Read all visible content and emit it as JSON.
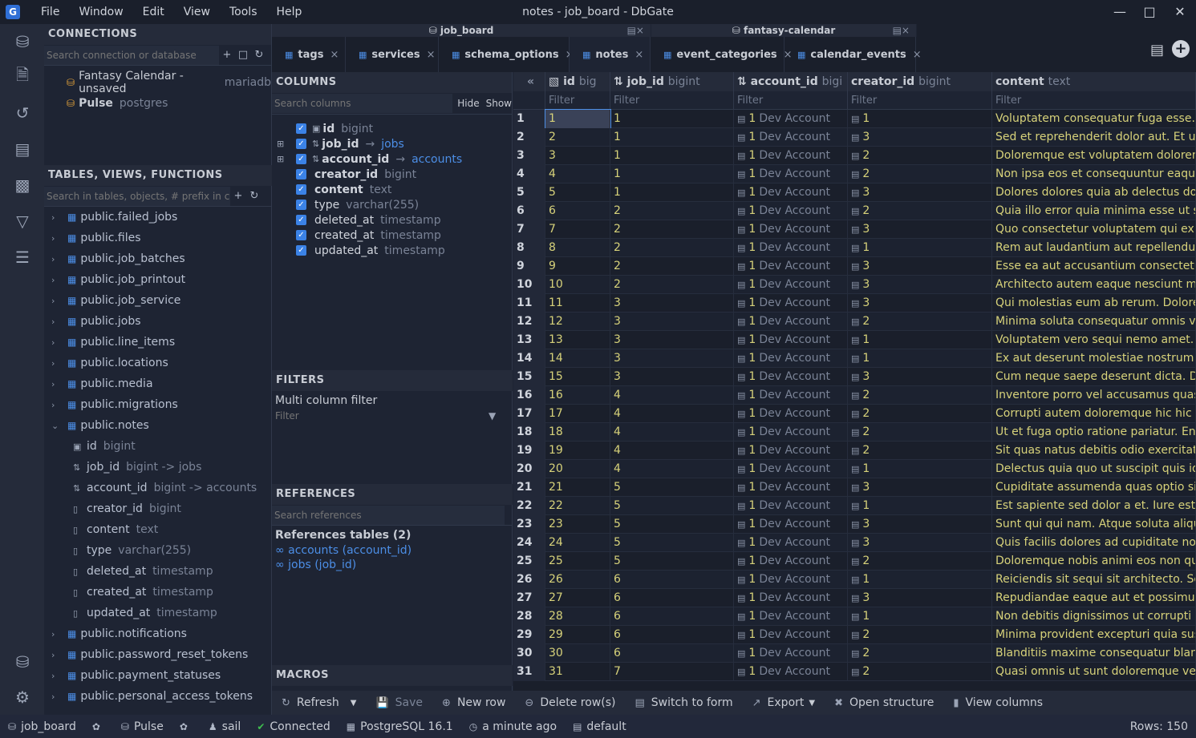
{
  "title": "notes - job_board - DbGate",
  "menu": [
    "File",
    "Window",
    "Edit",
    "View",
    "Tools",
    "Help"
  ],
  "connections": {
    "header": "CONNECTIONS",
    "search_placeholder": "Search connection or database",
    "items": [
      {
        "name": "Fantasy Calendar - unsaved",
        "driver": "mariadb"
      },
      {
        "name": "Pulse",
        "driver": "postgres"
      }
    ]
  },
  "tables": {
    "header": "TABLES, VIEWS, FUNCTIONS",
    "search_placeholder": "Search in tables, objects, # prefix in col",
    "items_before": [
      "public.failed_jobs",
      "public.files",
      "public.job_batches",
      "public.job_printout",
      "public.job_service",
      "public.jobs",
      "public.line_items",
      "public.locations",
      "public.media",
      "public.migrations",
      "public.notes"
    ],
    "notes_columns": [
      {
        "name": "id",
        "type": "bigint"
      },
      {
        "name": "job_id",
        "type": "bigint -> jobs"
      },
      {
        "name": "account_id",
        "type": "bigint -> accounts"
      },
      {
        "name": "creator_id",
        "type": "bigint"
      },
      {
        "name": "content",
        "type": "text"
      },
      {
        "name": "type",
        "type": "varchar(255)"
      },
      {
        "name": "deleted_at",
        "type": "timestamp"
      },
      {
        "name": "created_at",
        "type": "timestamp"
      },
      {
        "name": "updated_at",
        "type": "timestamp"
      }
    ],
    "items_after": [
      "public.notifications",
      "public.password_reset_tokens",
      "public.payment_statuses",
      "public.personal_access_tokens"
    ]
  },
  "tab_groups": [
    "job_board",
    "fantasy-calendar"
  ],
  "tabs": [
    {
      "label": "tags"
    },
    {
      "label": "services"
    },
    {
      "label": "schema_options"
    },
    {
      "label": "notes"
    },
    {
      "label": "event_categories"
    },
    {
      "label": "calendar_events"
    }
  ],
  "columns_panel": {
    "header": "COLUMNS",
    "search_placeholder": "Search columns",
    "hide_label": "Hide",
    "show_label": "Show",
    "columns": [
      {
        "name": "id",
        "type": "bigint",
        "link": ""
      },
      {
        "name": "job_id",
        "type": "",
        "link": "jobs"
      },
      {
        "name": "account_id",
        "type": "",
        "link": "accounts"
      },
      {
        "name": "creator_id",
        "type": "bigint",
        "link": ""
      },
      {
        "name": "content",
        "type": "text",
        "link": ""
      },
      {
        "name": "type",
        "type": "varchar(255)",
        "link": ""
      },
      {
        "name": "deleted_at",
        "type": "timestamp",
        "link": ""
      },
      {
        "name": "created_at",
        "type": "timestamp",
        "link": ""
      },
      {
        "name": "updated_at",
        "type": "timestamp",
        "link": ""
      }
    ]
  },
  "filters_panel": {
    "header": "FILTERS",
    "multi_label": "Multi column filter",
    "filter_placeholder": "Filter"
  },
  "references_panel": {
    "header": "REFERENCES",
    "search_placeholder": "Search references",
    "tables_title": "References tables (2)",
    "links": [
      "accounts (account_id)",
      "jobs (job_id)"
    ]
  },
  "macros_header": "MACROS",
  "grid": {
    "headers": [
      {
        "name": "id",
        "type": "big"
      },
      {
        "name": "job_id",
        "type": "bigint"
      },
      {
        "name": "account_id",
        "type": "bigi"
      },
      {
        "name": "creator_id",
        "type": "bigint"
      },
      {
        "name": "content",
        "type": "text"
      }
    ],
    "filter_placeholder": "Filter",
    "account_label": "Dev Account",
    "rows": [
      {
        "n": "1",
        "id": "1",
        "job": "1",
        "acc": "1",
        "cr": "1",
        "content": "Voluptatem consequatur fuga esse. Qu"
      },
      {
        "n": "2",
        "id": "2",
        "job": "1",
        "acc": "1",
        "cr": "3",
        "content": "Sed et reprehenderit dolor aut. Et ut e"
      },
      {
        "n": "3",
        "id": "3",
        "job": "1",
        "acc": "1",
        "cr": "2",
        "content": "Doloremque est voluptatem dolorem."
      },
      {
        "n": "4",
        "id": "4",
        "job": "1",
        "acc": "1",
        "cr": "2",
        "content": "Non ipsa eos et consequuntur eaque v"
      },
      {
        "n": "5",
        "id": "5",
        "job": "1",
        "acc": "1",
        "cr": "3",
        "content": "Dolores dolores quia ab delectus dolo"
      },
      {
        "n": "6",
        "id": "6",
        "job": "2",
        "acc": "1",
        "cr": "2",
        "content": "Quia illo error quia minima esse ut sap"
      },
      {
        "n": "7",
        "id": "7",
        "job": "2",
        "acc": "1",
        "cr": "3",
        "content": "Quo consectetur voluptatem qui explic"
      },
      {
        "n": "8",
        "id": "8",
        "job": "2",
        "acc": "1",
        "cr": "1",
        "content": "Rem aut laudantium aut repellendus r"
      },
      {
        "n": "9",
        "id": "9",
        "job": "2",
        "acc": "1",
        "cr": "3",
        "content": "Esse ea aut accusantium consectetur a"
      },
      {
        "n": "10",
        "id": "10",
        "job": "2",
        "acc": "1",
        "cr": "3",
        "content": "Architecto autem eaque nesciunt minu"
      },
      {
        "n": "11",
        "id": "11",
        "job": "3",
        "acc": "1",
        "cr": "3",
        "content": "Qui molestias eum ab rerum. Dolore e"
      },
      {
        "n": "12",
        "id": "12",
        "job": "3",
        "acc": "1",
        "cr": "2",
        "content": "Minima soluta consequatur omnis volu"
      },
      {
        "n": "13",
        "id": "13",
        "job": "3",
        "acc": "1",
        "cr": "1",
        "content": "Voluptatem vero sequi nemo amet. Ea"
      },
      {
        "n": "14",
        "id": "14",
        "job": "3",
        "acc": "1",
        "cr": "1",
        "content": "Ex aut deserunt molestiae nostrum ut"
      },
      {
        "n": "15",
        "id": "15",
        "job": "3",
        "acc": "1",
        "cr": "3",
        "content": "Cum neque saepe deserunt dicta. Dist"
      },
      {
        "n": "16",
        "id": "16",
        "job": "4",
        "acc": "1",
        "cr": "2",
        "content": "Inventore porro vel accusamus quas q"
      },
      {
        "n": "17",
        "id": "17",
        "job": "4",
        "acc": "1",
        "cr": "2",
        "content": "Corrupti autem doloremque hic hic illo"
      },
      {
        "n": "18",
        "id": "18",
        "job": "4",
        "acc": "1",
        "cr": "2",
        "content": "Ut et fuga optio ratione pariatur. Enim"
      },
      {
        "n": "19",
        "id": "19",
        "job": "4",
        "acc": "1",
        "cr": "2",
        "content": "Sit quas natus debitis odio exercitation"
      },
      {
        "n": "20",
        "id": "20",
        "job": "4",
        "acc": "1",
        "cr": "1",
        "content": "Delectus quia quo ut suscipit quis id re"
      },
      {
        "n": "21",
        "id": "21",
        "job": "5",
        "acc": "1",
        "cr": "3",
        "content": "Cupiditate assumenda quas optio sint"
      },
      {
        "n": "22",
        "id": "22",
        "job": "5",
        "acc": "1",
        "cr": "1",
        "content": "Est sapiente sed dolor a et. Iure est vo"
      },
      {
        "n": "23",
        "id": "23",
        "job": "5",
        "acc": "1",
        "cr": "3",
        "content": "Sunt qui qui nam. Atque soluta aliquid"
      },
      {
        "n": "24",
        "id": "24",
        "job": "5",
        "acc": "1",
        "cr": "3",
        "content": "Quis facilis dolores ad cupiditate non"
      },
      {
        "n": "25",
        "id": "25",
        "job": "5",
        "acc": "1",
        "cr": "2",
        "content": "Doloremque nobis animi eos non quid"
      },
      {
        "n": "26",
        "id": "26",
        "job": "6",
        "acc": "1",
        "cr": "1",
        "content": "Reiciendis sit sequi sit architecto. Sed"
      },
      {
        "n": "27",
        "id": "27",
        "job": "6",
        "acc": "1",
        "cr": "3",
        "content": "Repudiandae eaque aut et possimus. S"
      },
      {
        "n": "28",
        "id": "28",
        "job": "6",
        "acc": "1",
        "cr": "1",
        "content": "Non debitis dignissimos ut corrupti ev"
      },
      {
        "n": "29",
        "id": "29",
        "job": "6",
        "acc": "1",
        "cr": "2",
        "content": "Minima provident excepturi quia susci"
      },
      {
        "n": "30",
        "id": "30",
        "job": "6",
        "acc": "1",
        "cr": "2",
        "content": "Blanditiis maxime consequatur blandi"
      },
      {
        "n": "31",
        "id": "31",
        "job": "7",
        "acc": "1",
        "cr": "2",
        "content": "Quasi omnis ut sunt doloremque verit"
      }
    ]
  },
  "toolbar": {
    "refresh": "Refresh",
    "save": "Save",
    "new_row": "New row",
    "delete_rows": "Delete row(s)",
    "switch_to_form": "Switch to form",
    "export": "Export",
    "open_structure": "Open structure",
    "view_columns": "View columns"
  },
  "status": {
    "db": "job_board",
    "connection": "Pulse",
    "user": "sail",
    "state": "Connected",
    "engine": "PostgreSQL 16.1",
    "time": "a minute ago",
    "schema": "default",
    "rows": "Rows: 150"
  },
  "colors": {
    "accent": "#4c8ee6",
    "value": "#d7d27a",
    "ok": "#3fbf4f"
  }
}
